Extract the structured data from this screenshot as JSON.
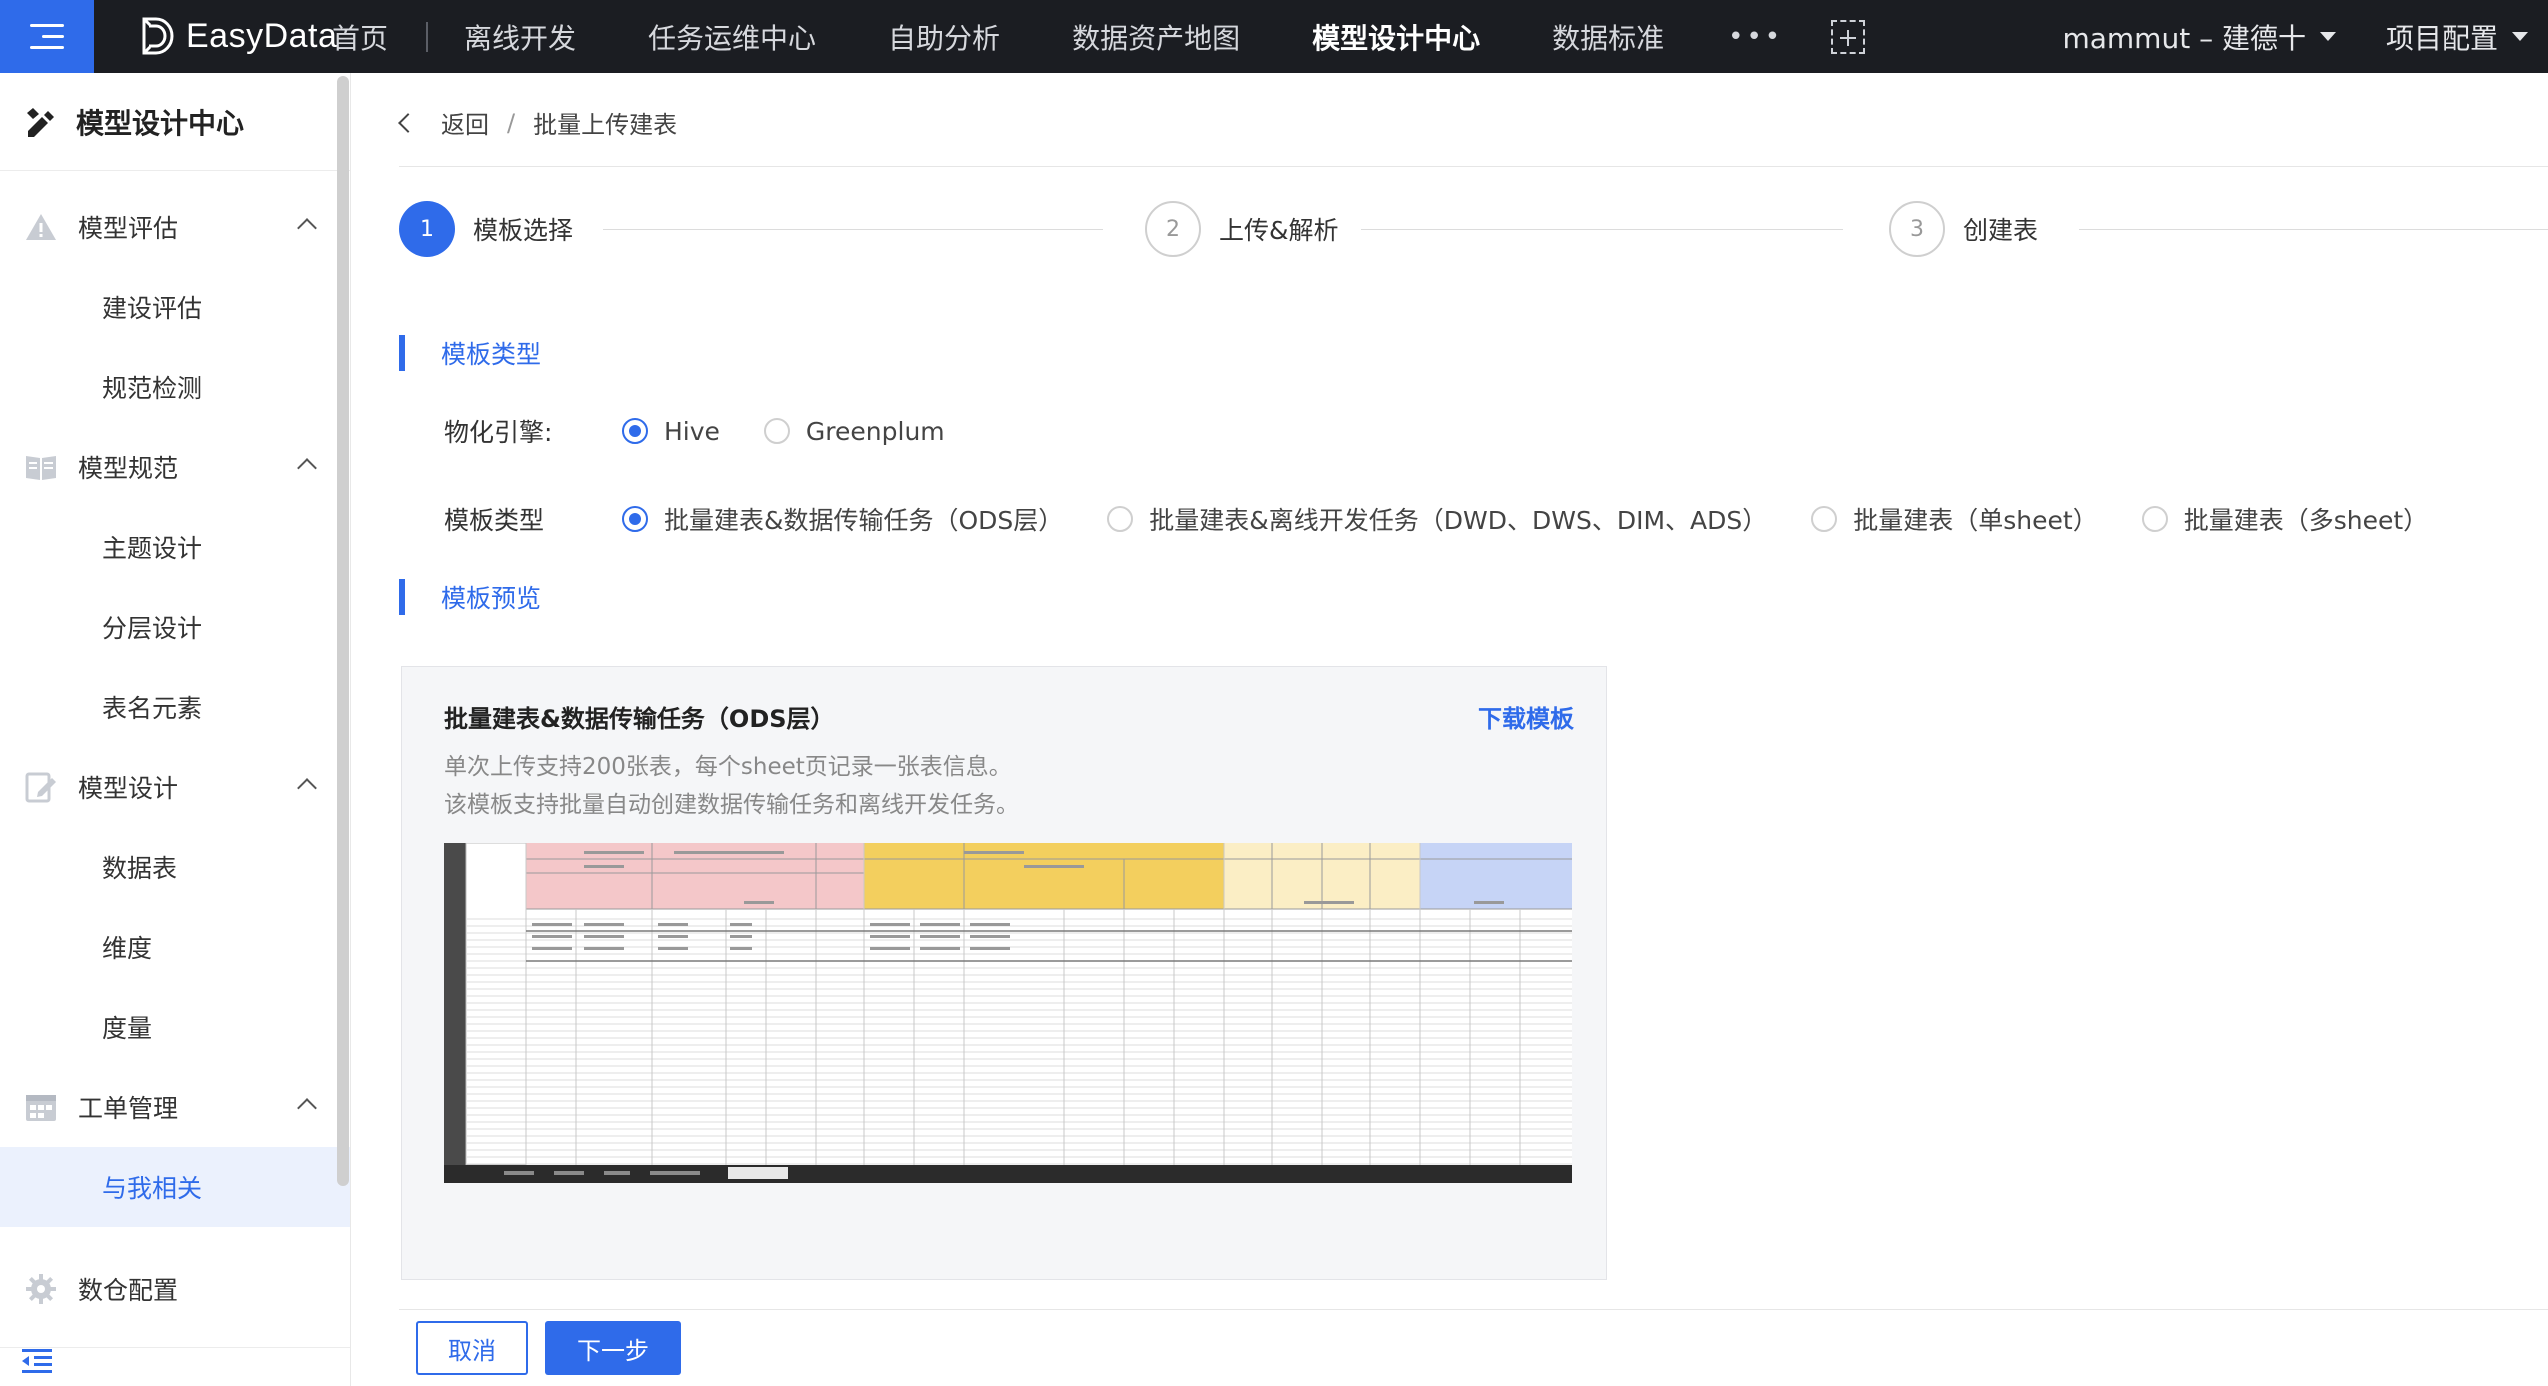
{
  "topbar": {
    "brand": "EasyData",
    "nav": [
      "首页",
      "离线开发",
      "任务运维中心",
      "自助分析",
      "数据资产地图",
      "模型设计中心",
      "数据标准"
    ],
    "active_nav": "模型设计中心",
    "more": "•••",
    "user": "mammut – 建德十",
    "project_config": "项目配置"
  },
  "sidebar": {
    "title": "模型设计中心",
    "groups": [
      {
        "label": "模型评估",
        "items": [
          "建设评估",
          "规范检测"
        ]
      },
      {
        "label": "模型规范",
        "items": [
          "主题设计",
          "分层设计",
          "表名元素"
        ]
      },
      {
        "label": "模型设计",
        "items": [
          "数据表",
          "维度",
          "度量"
        ]
      },
      {
        "label": "工单管理",
        "items": [
          "与我相关"
        ]
      }
    ],
    "active_item": "与我相关",
    "bottom_item": "数仓配置"
  },
  "breadcrumb": {
    "back": "返回",
    "sep": "/",
    "current": "批量上传建表"
  },
  "steps": [
    {
      "num": "1",
      "label": "模板选择",
      "state": "active"
    },
    {
      "num": "2",
      "label": "上传&解析",
      "state": "pending"
    },
    {
      "num": "3",
      "label": "创建表",
      "state": "pending"
    }
  ],
  "section_template_type": "模板类型",
  "engine": {
    "label": "物化引擎:",
    "options": [
      "Hive",
      "Greenplum"
    ],
    "selected": "Hive"
  },
  "template_type": {
    "label": "模板类型",
    "options": [
      "批量建表&数据传输任务（ODS层）",
      "批量建表&离线开发任务（DWD、DWS、DIM、ADS）",
      "批量建表（单sheet）",
      "批量建表（多sheet）"
    ],
    "selected": "批量建表&数据传输任务（ODS层）"
  },
  "section_preview": "模板预览",
  "preview": {
    "title": "批量建表&数据传输任务（ODS层）",
    "download": "下载模板",
    "desc1": "单次上传支持200张表，每个sheet页记录一张表信息。",
    "desc2": "该模板支持批量自动创建数据传输任务和离线开发任务。"
  },
  "buttons": {
    "cancel": "取消",
    "next": "下一步"
  },
  "colors": {
    "accent": "#2f6bea",
    "topbar": "#1b1d22",
    "sheet_red": "#f4c7c9",
    "sheet_yellow": "#f3cf5e",
    "sheet_cream": "#fbeec5",
    "sheet_blue": "#c6d4f6"
  }
}
